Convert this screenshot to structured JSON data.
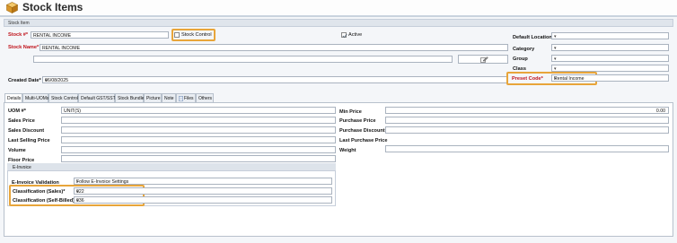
{
  "window": {
    "title": "Stock Items"
  },
  "section": {
    "title": "Stock Item"
  },
  "header_fields": {
    "stock_no_label": "Stock #*",
    "stock_no_value": "RENTAL INCOME",
    "stock_control_label": "Stock Control",
    "active_label": "Active",
    "stock_name_label": "Stock Name*",
    "stock_name_value": "RENTAL INCOME",
    "created_date_label": "Created Date*",
    "created_date_value": "06/08/2025",
    "default_location_label": "Default Location",
    "category_label": "Category",
    "group_label": "Group",
    "class_label": "Class",
    "preset_code_label": "Preset Code*",
    "preset_code_value": "Rental Income"
  },
  "tabs": [
    "Details",
    "Multi-UOMs",
    "Stock Control",
    "Default GST/SST",
    "Stock Bundle",
    "Picture",
    "Note",
    "Files",
    "Others"
  ],
  "details": {
    "uom_label": "UOM #*",
    "uom_value": "UNIT(S)",
    "sales_price_label": "Sales Price",
    "sales_discount_label": "Sales Discount",
    "last_selling_price_label": "Last Selling Price",
    "volume_label": "Volume",
    "floor_price_label": "Floor Price",
    "min_price_label": "Min Price",
    "min_price_value": "0.00",
    "purchase_price_label": "Purchase Price",
    "purchase_discount_label": "Purchase Discount",
    "last_purchase_price_label": "Last Purchase Price",
    "weight_label": "Weight"
  },
  "einvoice": {
    "header": "E-Invoice",
    "validation_label": "E-Invoice Validation",
    "validation_value": "Follow E-Invoice Settings",
    "class_sales_label": "Classification (Sales)*",
    "class_sales_value": "022",
    "class_self_label": "Classification (Self-Billed)*",
    "class_self_value": "036"
  },
  "colors": {
    "highlight": "#e8a53a",
    "required": "#c0141c",
    "accent_icon": "#e0a030"
  }
}
